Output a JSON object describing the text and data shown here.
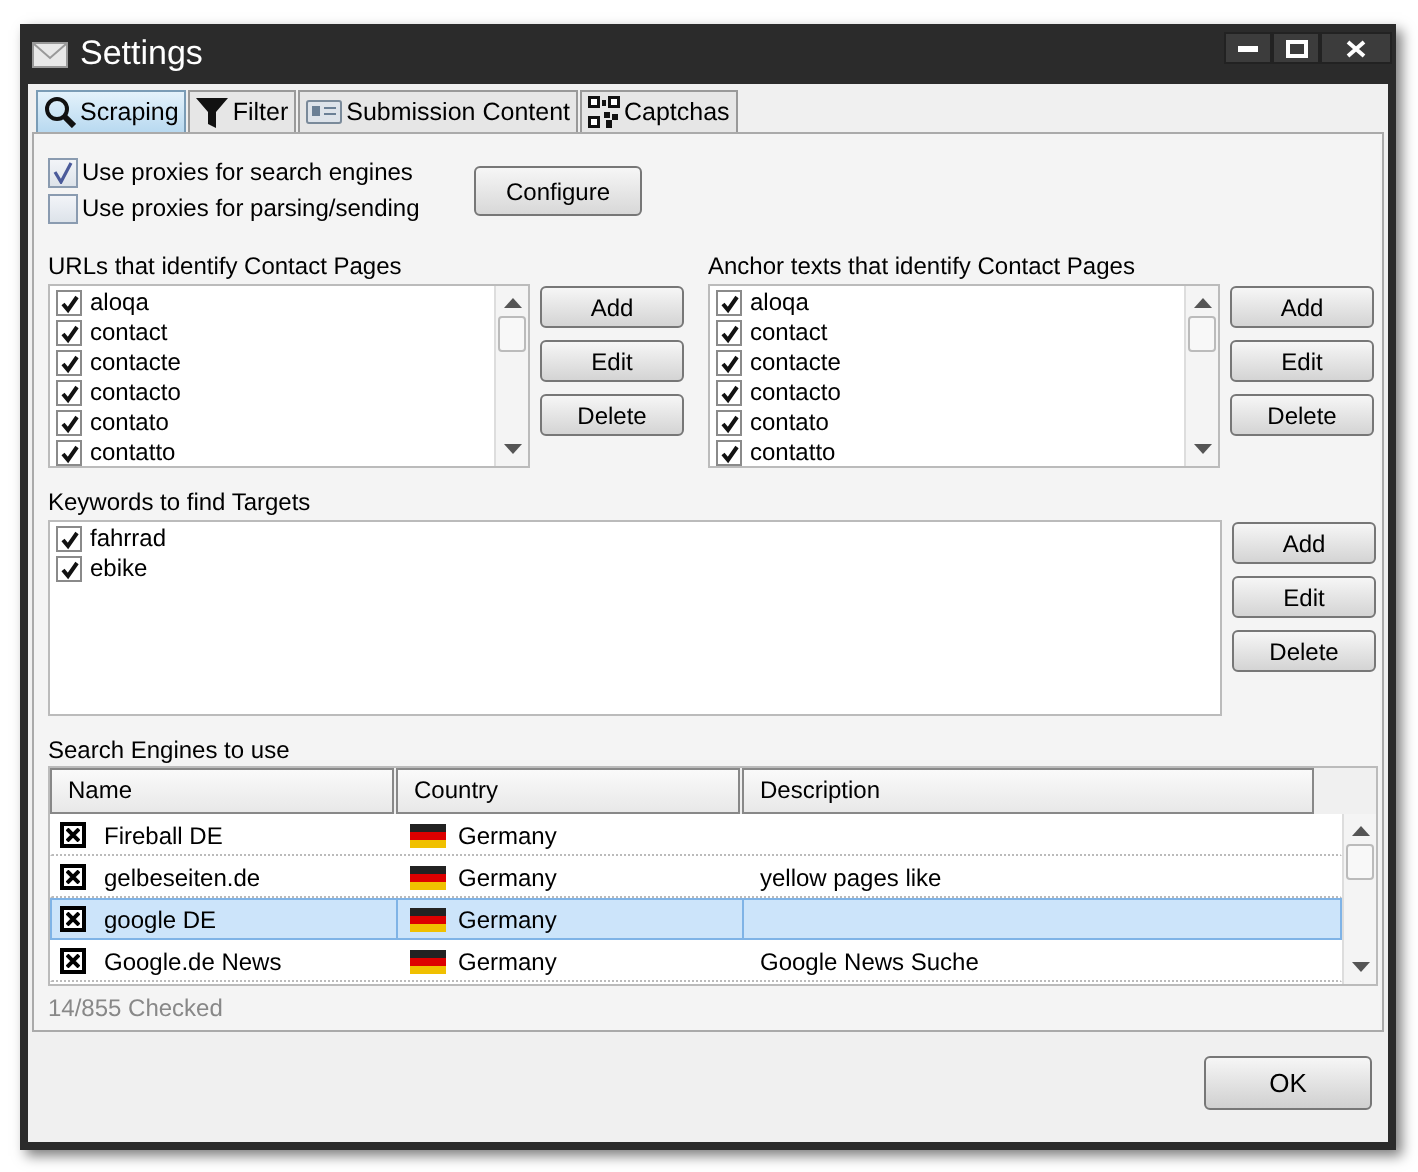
{
  "window": {
    "title": "Settings"
  },
  "tabs": [
    {
      "label": "Scraping",
      "selected": true,
      "kind": "search"
    },
    {
      "label": "Filter",
      "selected": false,
      "kind": "filter"
    },
    {
      "label": "Submission Content",
      "selected": false,
      "kind": "card"
    },
    {
      "label": "Captchas",
      "selected": false,
      "kind": "qr"
    }
  ],
  "proxy_options": [
    {
      "label": "Use proxies for search engines",
      "checked": true
    },
    {
      "label": "Use proxies for parsing/sending",
      "checked": false
    }
  ],
  "configure_button": "Configure",
  "url_list": {
    "label": "URLs that identify Contact Pages",
    "buttons": [
      "Add",
      "Edit",
      "Delete"
    ],
    "items": [
      {
        "text": "aloqa",
        "checked": true
      },
      {
        "text": "contact",
        "checked": true
      },
      {
        "text": "contacte",
        "checked": true
      },
      {
        "text": "contacto",
        "checked": true
      },
      {
        "text": "contato",
        "checked": true
      },
      {
        "text": "contatto",
        "checked": true
      }
    ]
  },
  "anchor_list": {
    "label": "Anchor texts that identify Contact Pages",
    "buttons": [
      "Add",
      "Edit",
      "Delete"
    ],
    "items": [
      {
        "text": "aloqa",
        "checked": true
      },
      {
        "text": "contact",
        "checked": true
      },
      {
        "text": "contacte",
        "checked": true
      },
      {
        "text": "contacto",
        "checked": true
      },
      {
        "text": "contato",
        "checked": true
      },
      {
        "text": "contatto",
        "checked": true
      }
    ]
  },
  "keywords": {
    "label": "Keywords to find Targets",
    "buttons": [
      "Add",
      "Edit",
      "Delete"
    ],
    "items": [
      {
        "text": "fahrrad",
        "checked": true
      },
      {
        "text": "ebike",
        "checked": true
      }
    ]
  },
  "search_engines": {
    "label": "Search Engines to use",
    "columns": [
      "Name",
      "Country",
      "Description"
    ],
    "rows": [
      {
        "checked": true,
        "name": "Fireball DE",
        "country": "Germany",
        "selected": false
      },
      {
        "checked": true,
        "name": "gelbeseiten.de",
        "country": "Germany",
        "description": "yellow pages like",
        "selected": false
      },
      {
        "checked": true,
        "name": "google DE",
        "country": "Germany",
        "selected": true
      },
      {
        "checked": true,
        "name": "Google.de News",
        "country": "Germany",
        "description": "Google News Suche",
        "selected": false
      }
    ]
  },
  "checked_count": "14/855 Checked",
  "ok_button": "OK"
}
